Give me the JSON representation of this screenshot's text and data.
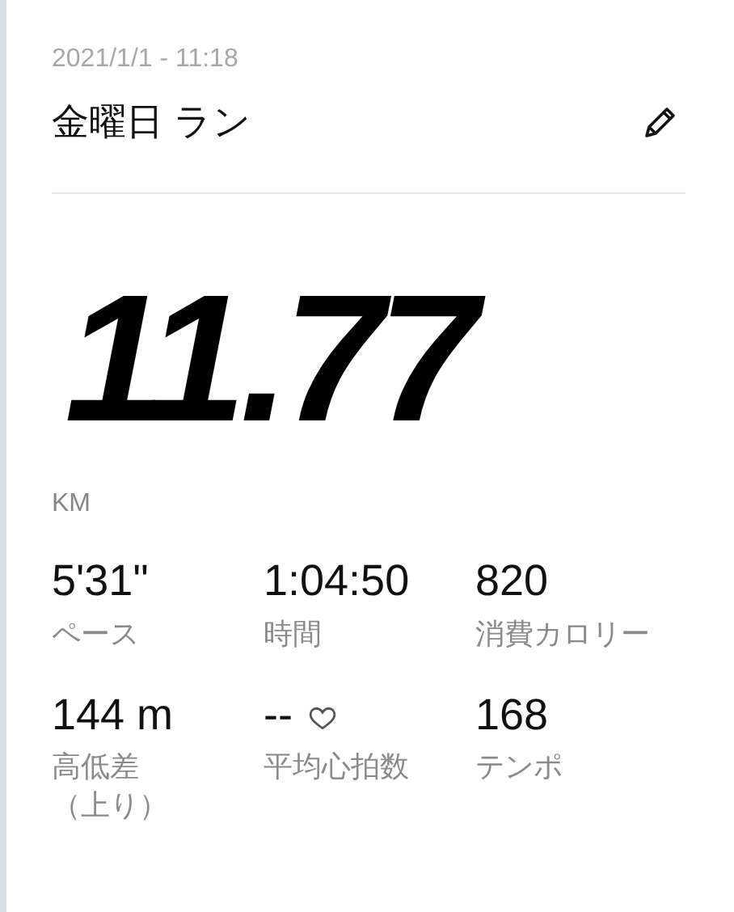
{
  "header": {
    "date": "2021/1/1 - 11:18",
    "title": "金曜日 ラン"
  },
  "distance": {
    "value": "11.77",
    "unit": "KM"
  },
  "stats": [
    {
      "kind": "plain",
      "value": "5'31\"",
      "label_lines": [
        "ペース"
      ]
    },
    {
      "kind": "plain",
      "value": "1:04:50",
      "label_lines": [
        "時間"
      ]
    },
    {
      "kind": "plain",
      "value": "820",
      "label_lines": [
        "消費カロリー"
      ]
    },
    {
      "kind": "plain",
      "value": "144 m",
      "label_lines": [
        "高低差",
        "（上り）"
      ]
    },
    {
      "kind": "heart",
      "value": "--",
      "label_lines": [
        "平均心拍数"
      ]
    },
    {
      "kind": "plain",
      "value": "168",
      "label_lines": [
        "テンポ"
      ]
    }
  ]
}
